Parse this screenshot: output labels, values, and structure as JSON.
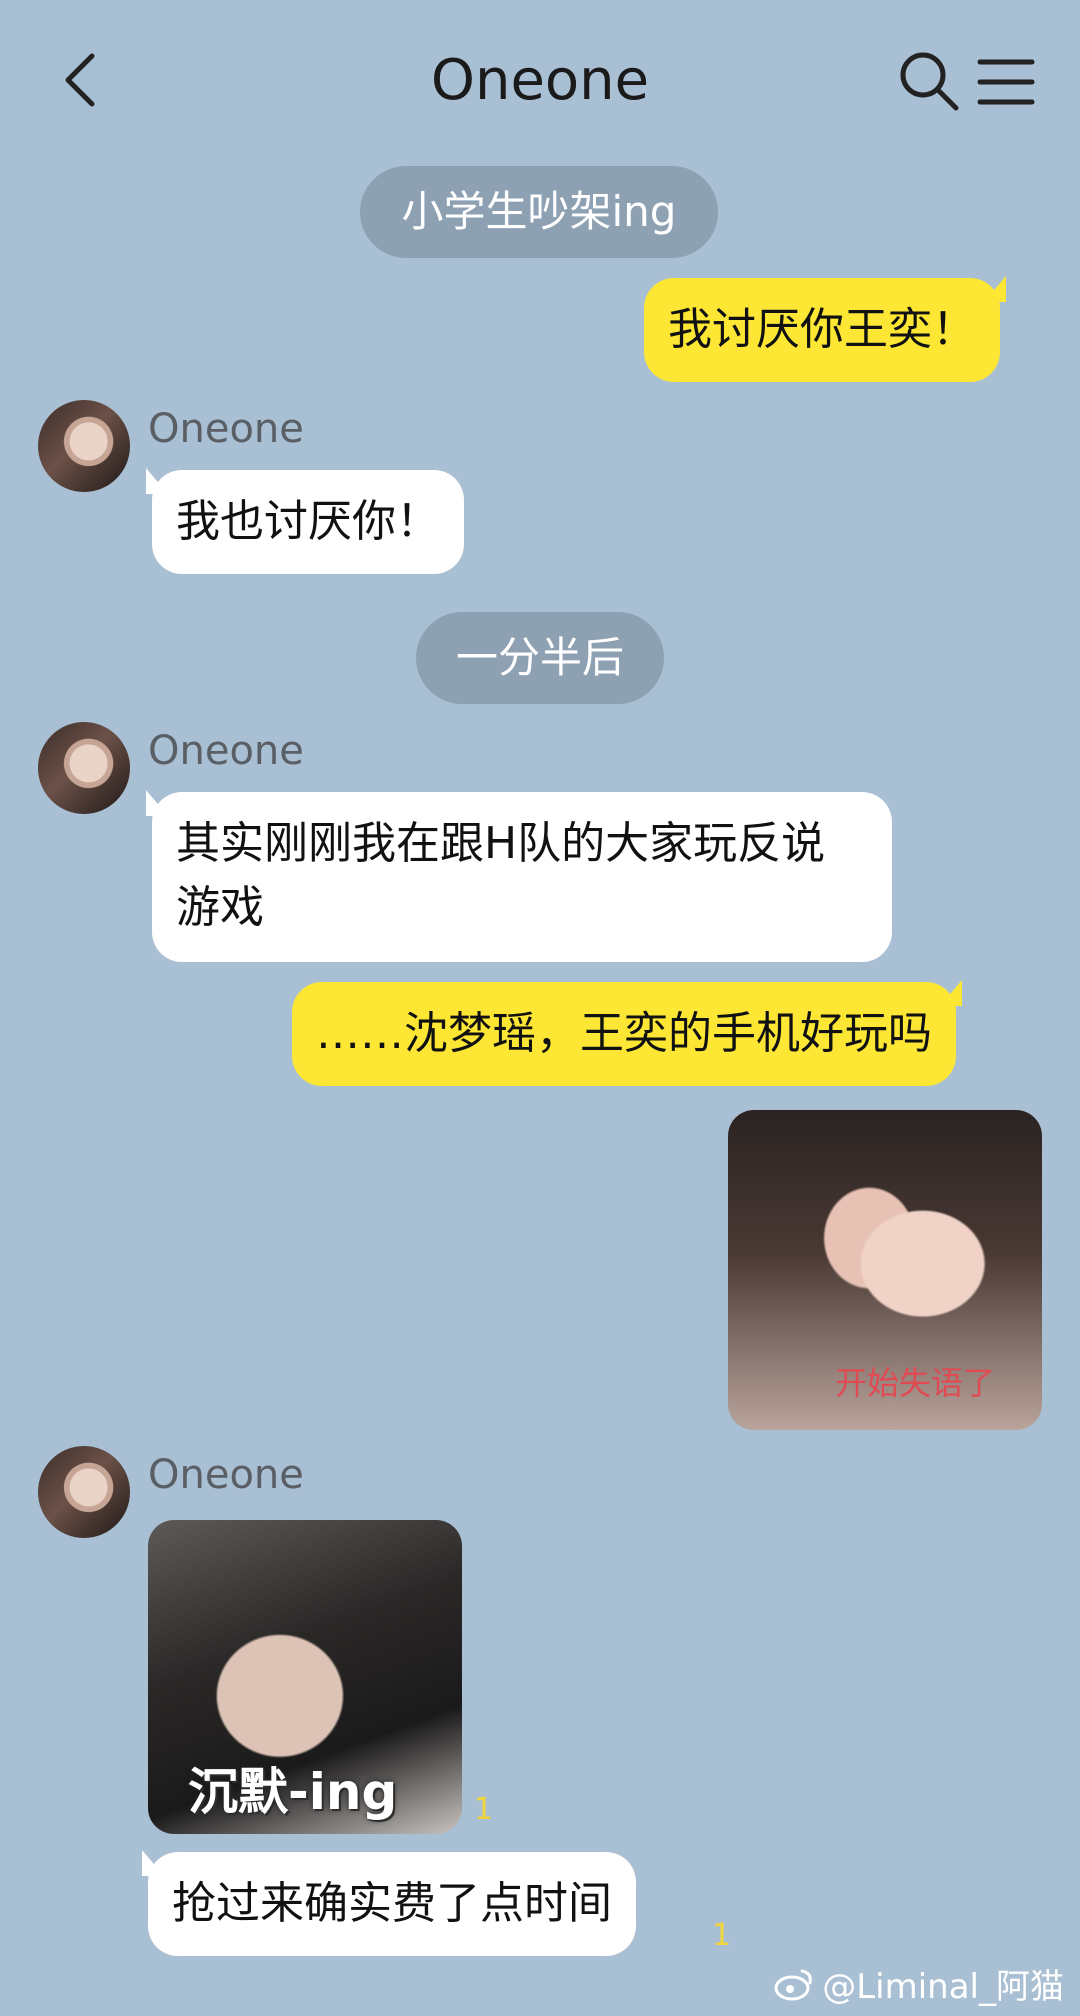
{
  "header": {
    "title": "Oneone"
  },
  "messages": {
    "sys1": "小学生吵架ing",
    "me1": "我讨厌你王奕！",
    "them1_sender": "Oneone",
    "them1": "我也讨厌你！",
    "sys2": "一分半后",
    "them2_sender": "Oneone",
    "them2": "其实刚刚我在跟H队的大家玩反说游戏",
    "me2": "……沈梦瑶，王奕的手机好玩吗",
    "me_sticker_caption": "开始失语了",
    "them3_sender": "Oneone",
    "them_sticker_caption": "沉默-ing",
    "them_sticker_read": "1",
    "them4": "抢过来确实费了点时间",
    "them4_read": "1"
  },
  "watermark": {
    "text": "@Liminal_阿猫"
  },
  "colors": {
    "background": "#a9bfd3",
    "my_bubble": "#fde734",
    "their_bubble": "#ffffff",
    "system_pill": "#8da1b3"
  },
  "icons": [
    "back-arrow-icon",
    "search-icon",
    "menu-icon",
    "weibo-icon"
  ]
}
